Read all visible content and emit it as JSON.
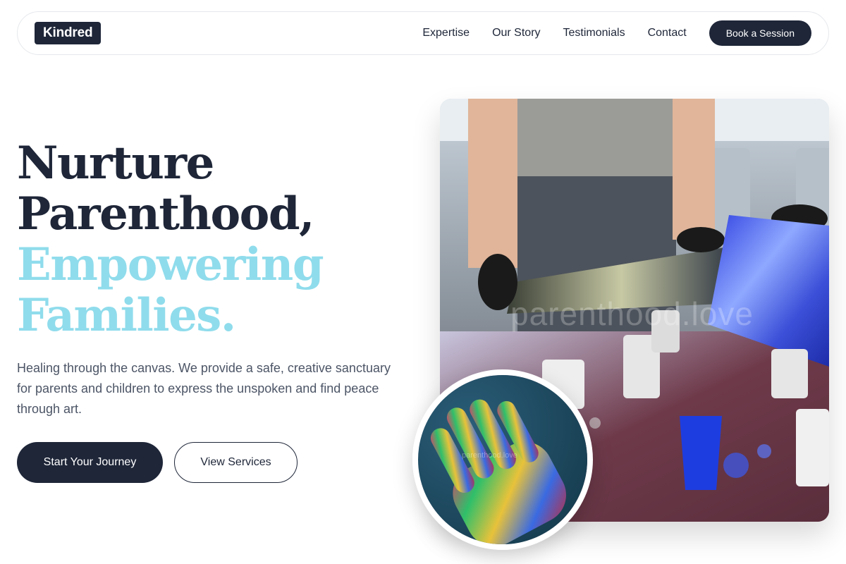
{
  "nav": {
    "logo": "Kindred",
    "links": [
      "Expertise",
      "Our Story",
      "Testimonials",
      "Contact"
    ],
    "cta": "Book a Session"
  },
  "hero": {
    "title_line1": "Nurture",
    "title_line2": "Parenthood,",
    "title_line3": "Empowering",
    "title_line4": "Families.",
    "description": "Healing through the canvas. We provide a safe, creative sanctuary for parents and children to express the unspoken and find peace through art.",
    "primary_button": "Start Your Journey",
    "secondary_button": "View Services"
  },
  "images": {
    "main_watermark": "parenthood.love",
    "circle_watermark": "parenthood.love"
  },
  "colors": {
    "navy": "#1e2638",
    "accent": "#8fdcec",
    "body_text": "#4c5566"
  }
}
